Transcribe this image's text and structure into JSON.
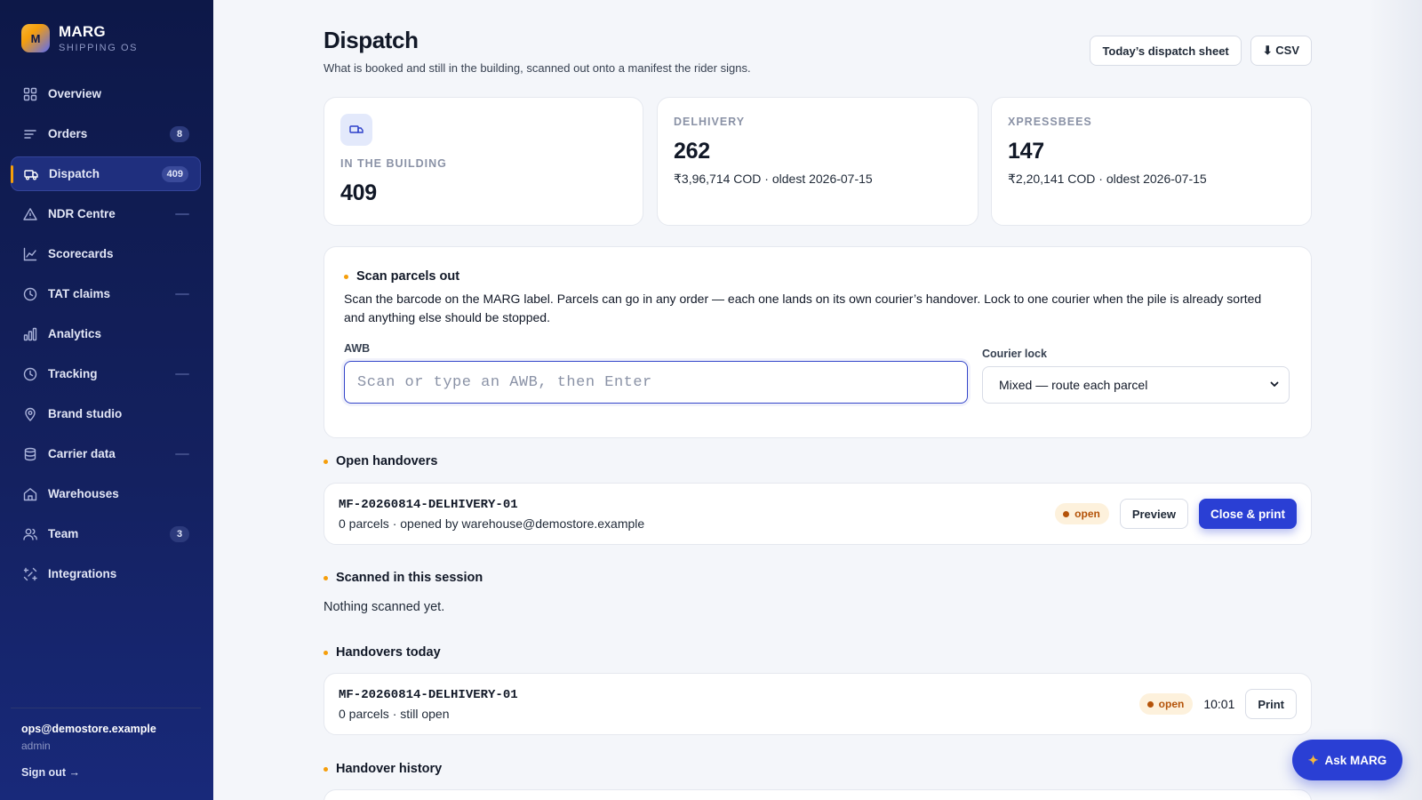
{
  "brand": {
    "logo_letter": "M",
    "name": "MARG",
    "subtitle": "SHIPPING OS"
  },
  "sidebar": {
    "items": [
      {
        "label": "Overview",
        "icon": "grid-icon",
        "badge": null,
        "dash": false,
        "active": false
      },
      {
        "label": "Orders",
        "icon": "list-icon",
        "badge": "8",
        "dash": false,
        "active": false
      },
      {
        "label": "Dispatch",
        "icon": "truck-icon",
        "badge": "409",
        "dash": false,
        "active": true
      },
      {
        "label": "NDR Centre",
        "icon": "warning-icon",
        "badge": null,
        "dash": true,
        "active": false
      },
      {
        "label": "Scorecards",
        "icon": "line-chart-icon",
        "badge": null,
        "dash": false,
        "active": false
      },
      {
        "label": "TAT claims",
        "icon": "clock-icon",
        "badge": null,
        "dash": true,
        "active": false
      },
      {
        "label": "Analytics",
        "icon": "bar-chart-icon",
        "badge": null,
        "dash": false,
        "active": false
      },
      {
        "label": "Tracking",
        "icon": "clock-icon",
        "badge": null,
        "dash": true,
        "active": false
      },
      {
        "label": "Brand studio",
        "icon": "location-pin-icon",
        "badge": null,
        "dash": false,
        "active": false
      },
      {
        "label": "Carrier data",
        "icon": "database-icon",
        "badge": null,
        "dash": true,
        "active": false
      },
      {
        "label": "Warehouses",
        "icon": "home-icon",
        "badge": null,
        "dash": false,
        "active": false
      },
      {
        "label": "Team",
        "icon": "users-icon",
        "badge": "3",
        "dash": false,
        "active": false
      },
      {
        "label": "Integrations",
        "icon": "plug-icon",
        "badge": null,
        "dash": false,
        "active": false
      }
    ],
    "user": {
      "email": "ops@demostore.example",
      "role": "admin",
      "signout": "Sign out →"
    }
  },
  "header": {
    "title": "Dispatch",
    "subtitle": "What is booked and still in the building, scanned out onto a manifest the rider signs.",
    "sheet_button": "Today’s dispatch sheet",
    "csv_button": "⬇ CSV"
  },
  "stats": {
    "building": {
      "label": "IN THE BUILDING",
      "value": "409"
    },
    "delhivery": {
      "label": "DELHIVERY",
      "value": "262",
      "meta": "₹3,96,714 COD · oldest 2026-07-15"
    },
    "xpressbees": {
      "label": "XPRESSBEES",
      "value": "147",
      "meta": "₹2,20,141 COD · oldest 2026-07-15"
    }
  },
  "scan": {
    "title": "Scan parcels out",
    "description": "Scan the barcode on the MARG label. Parcels can go in any order — each one lands on its own courier’s handover. Lock to one courier when the pile is already sorted and anything else should be stopped.",
    "awb_label": "AWB",
    "awb_placeholder": "Scan or type an AWB, then Enter",
    "courier_label": "Courier lock",
    "courier_value": "Mixed — route each parcel"
  },
  "open_handovers": {
    "title": "Open handovers",
    "row": {
      "id": "MF-20260814-DELHIVERY-01",
      "meta": "0 parcels · opened by warehouse@demostore.example",
      "status": "open",
      "preview": "Preview",
      "close": "Close & print"
    }
  },
  "session": {
    "title": "Scanned in this session",
    "empty": "Nothing scanned yet."
  },
  "today": {
    "title": "Handovers today",
    "row": {
      "id": "MF-20260814-DELHIVERY-01",
      "meta": "0 parcels · still open",
      "status": "open",
      "time": "10:01",
      "print": "Print"
    }
  },
  "history": {
    "title": "Handover history"
  },
  "ask": {
    "label": "Ask MARG",
    "star": "✦"
  },
  "colors": {
    "accent": "#2a3fd4",
    "sidebar": "#0d1848",
    "warning": "#f59e0b"
  }
}
